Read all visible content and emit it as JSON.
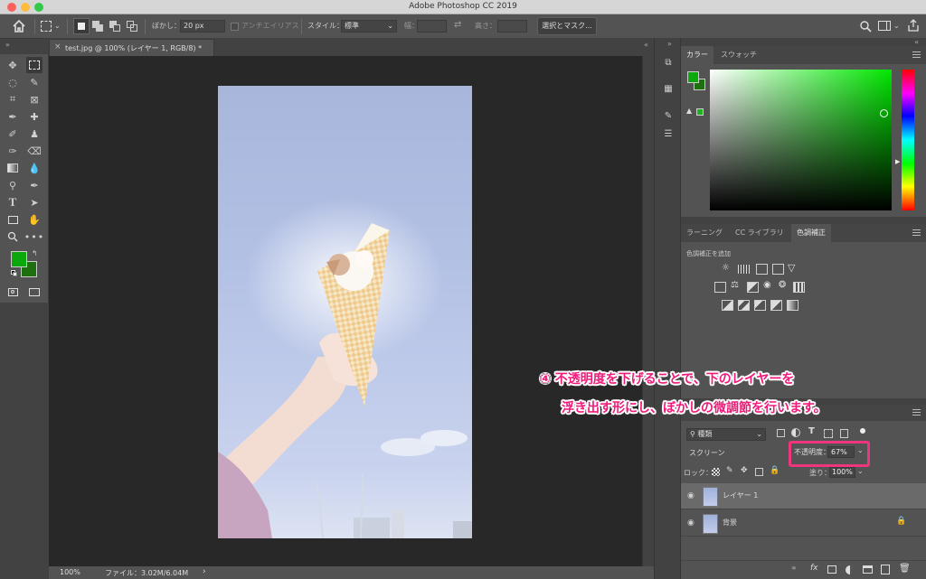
{
  "window": {
    "title": "Adobe Photoshop CC 2019"
  },
  "options_bar": {
    "feather_label": "ぼかし：",
    "feather_value": "20 px",
    "antialias_label": "アンチエイリアス",
    "style_label": "スタイル：",
    "style_value": "標準",
    "width_label": "幅：",
    "height_label": "高さ：",
    "select_mask_label": "選択とマスク..."
  },
  "document": {
    "tab_title": "test.jpg @ 100% (レイヤー 1, RGB/8) *",
    "zoom": "100%",
    "file_info": "ファイル：3.02M/6.04M"
  },
  "color_panel": {
    "tabs": [
      "カラー",
      "スウォッチ"
    ],
    "fg_color": "#0aa80a",
    "bg_color": "#1d6f10",
    "hue_color": "#00e600"
  },
  "adjust_panel": {
    "tabs": [
      "ラーニング",
      "CC ライブラリ",
      "色調補正"
    ],
    "add_label": "色調補正を追加"
  },
  "layers_panel": {
    "filter_label": "種類",
    "blend_mode": "スクリーン",
    "opacity_label": "不透明度：",
    "opacity_value": "67%",
    "lock_label": "ロック：",
    "fill_label": "塗り：",
    "fill_value": "100%",
    "layers": [
      {
        "name": "レイヤー 1",
        "selected": true
      },
      {
        "name": "背景",
        "locked": true
      }
    ]
  },
  "annotation": {
    "line1": "④ 不透明度を下げることで、下のレイヤーを",
    "line2": "浮き出す形にし、ぼかしの微調節を行います。",
    "color": "#f01a7a"
  }
}
